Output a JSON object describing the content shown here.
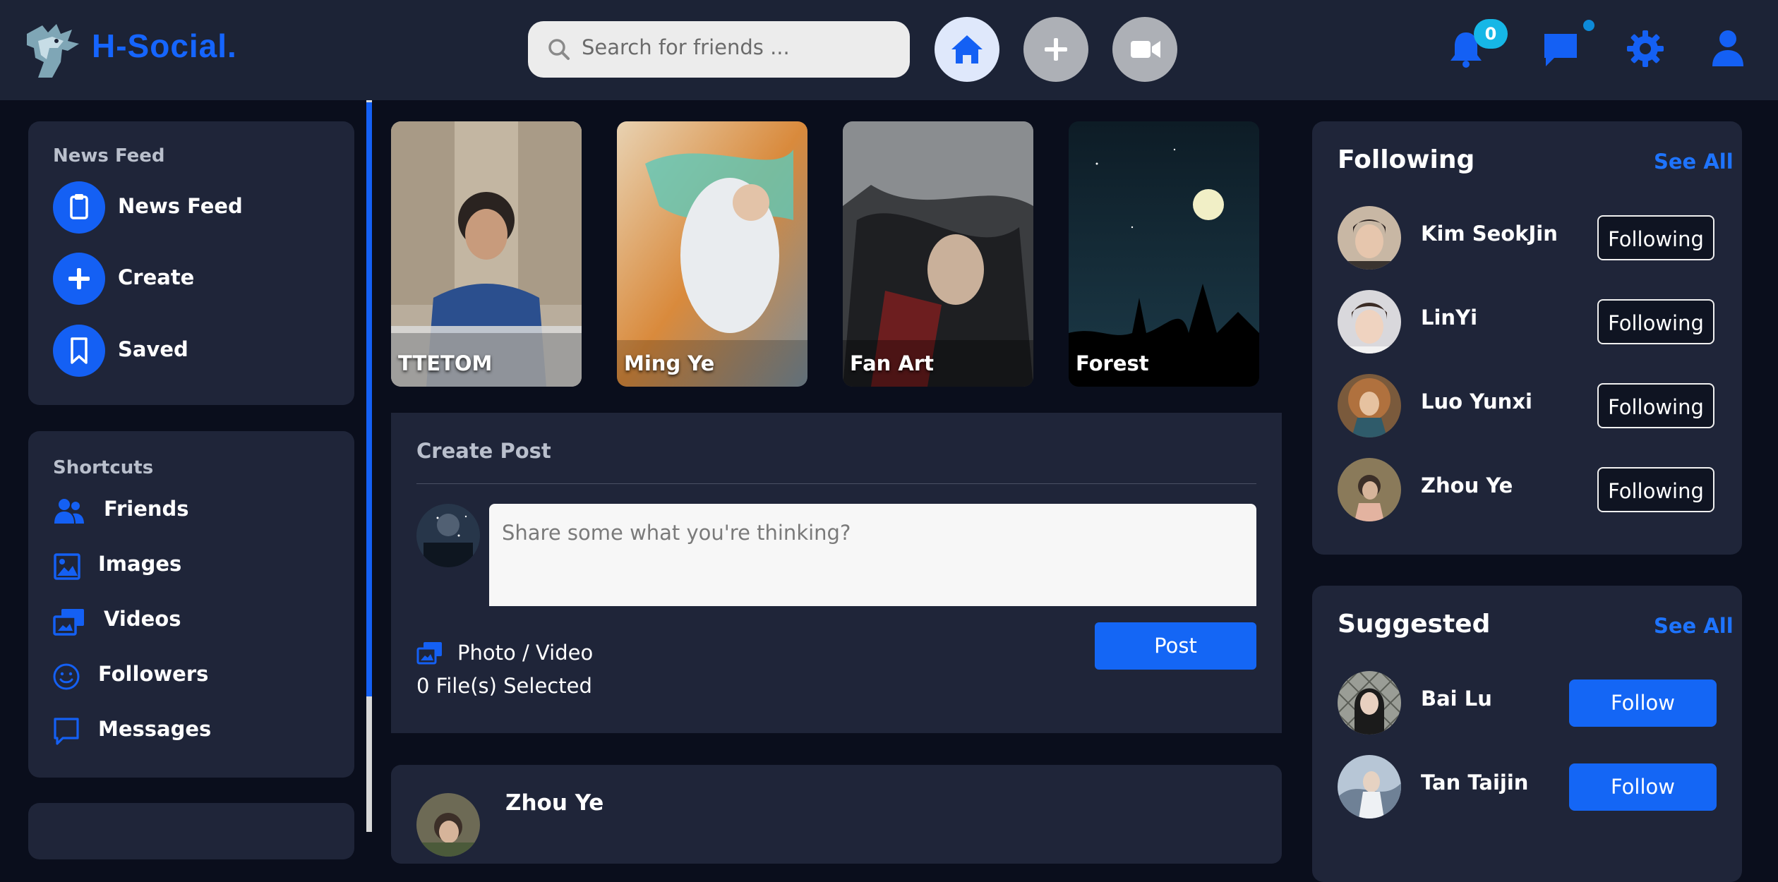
{
  "header": {
    "brand": "H-Social.",
    "search_placeholder": "Search for friends ...",
    "notification_count": "0",
    "colors": {
      "accent": "#1460f4",
      "badge": "#16b7e6",
      "topbar": "#1c2336"
    }
  },
  "sidebar": {
    "news_section": {
      "title": "News Feed",
      "items": [
        {
          "label": "News Feed",
          "icon": "clipboard-icon"
        },
        {
          "label": "Create",
          "icon": "plus-icon"
        },
        {
          "label": "Saved",
          "icon": "bookmark-icon"
        }
      ]
    },
    "shortcuts_section": {
      "title": "Shortcuts",
      "items": [
        {
          "label": "Friends",
          "icon": "users-icon"
        },
        {
          "label": "Images",
          "icon": "image-icon"
        },
        {
          "label": "Videos",
          "icon": "photo-video-icon"
        },
        {
          "label": "Followers",
          "icon": "smile-icon"
        },
        {
          "label": "Messages",
          "icon": "message-square-icon"
        }
      ]
    }
  },
  "stories": [
    {
      "label": "TTETOM"
    },
    {
      "label": "Ming Ye"
    },
    {
      "label": "Fan Art"
    },
    {
      "label": "Forest"
    }
  ],
  "create_post": {
    "title": "Create Post",
    "placeholder": "Share some what you're thinking?",
    "photo_video_label": "Photo / Video",
    "files_selected": "0 File(s) Selected",
    "post_button": "Post"
  },
  "feed": {
    "first_post_author": "Zhou Ye"
  },
  "following": {
    "title": "Following",
    "see_all": "See All",
    "button_label": "Following",
    "users": [
      {
        "name": "Kim SeokJin"
      },
      {
        "name": "LinYi"
      },
      {
        "name": "Luo Yunxi"
      },
      {
        "name": "Zhou Ye"
      }
    ]
  },
  "suggested": {
    "title": "Suggested",
    "see_all": "See All",
    "button_label": "Follow",
    "users": [
      {
        "name": "Bai Lu"
      },
      {
        "name": "Tan Taijin"
      }
    ]
  }
}
